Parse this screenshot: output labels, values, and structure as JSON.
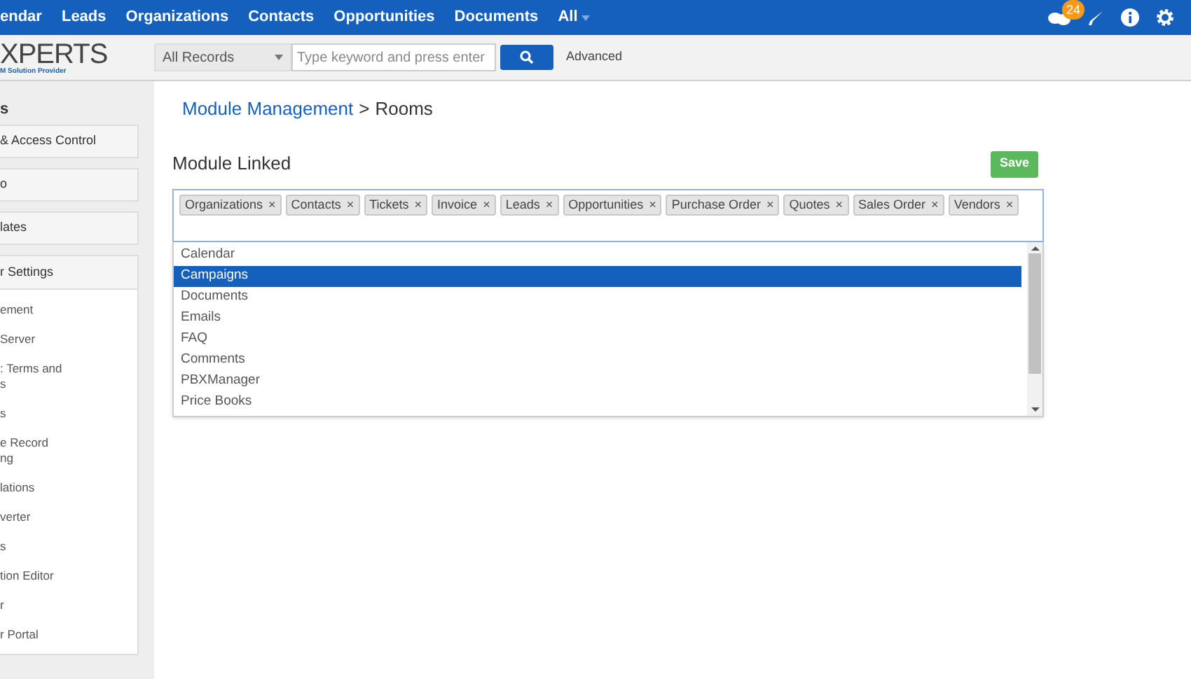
{
  "top_nav": {
    "items": [
      "endar",
      "Leads",
      "Organizations",
      "Contacts",
      "Opportunities",
      "Documents",
      "All"
    ],
    "notification_count": "24"
  },
  "header": {
    "logo": "XPERTS",
    "logo_tagline": "M Solution Provider",
    "search_scope": "All Records",
    "search": {
      "placeholder": "Type keyword and press enter"
    },
    "advanced": "Advanced"
  },
  "sidebar": {
    "title": "s",
    "panels": [
      "& Access Control",
      "o",
      "lates"
    ],
    "open_panel": {
      "title": "r Settings",
      "items": [
        {
          "lines": [
            "ement"
          ]
        },
        {
          "lines": [
            "Server"
          ]
        },
        {
          "lines": [
            ": Terms and",
            "s"
          ]
        },
        {
          "lines": [
            "s"
          ]
        },
        {
          "lines": [
            "e Record",
            "ng"
          ]
        },
        {
          "lines": [
            "lations"
          ]
        },
        {
          "lines": [
            "verter"
          ]
        },
        {
          "lines": [
            "s"
          ]
        },
        {
          "lines": [
            "tion Editor"
          ]
        },
        {
          "lines": [
            "r"
          ]
        },
        {
          "lines": [
            "r Portal"
          ]
        }
      ]
    }
  },
  "breadcrumb": {
    "link": "Module Management",
    "separator": ">",
    "current": "Rooms"
  },
  "section_title": "Module Linked",
  "save_button": "Save",
  "tags": [
    "Organizations",
    "Contacts",
    "Tickets",
    "Invoice",
    "Leads",
    "Opportunities",
    "Purchase Order",
    "Quotes",
    "Sales Order",
    "Vendors"
  ],
  "tag_remove": "×",
  "dropdown_options": [
    {
      "label": "Calendar",
      "selected": false
    },
    {
      "label": "Campaigns",
      "selected": true
    },
    {
      "label": "Documents",
      "selected": false
    },
    {
      "label": "Emails",
      "selected": false
    },
    {
      "label": "FAQ",
      "selected": false
    },
    {
      "label": "Comments",
      "selected": false
    },
    {
      "label": "PBXManager",
      "selected": false
    },
    {
      "label": "Price Books",
      "selected": false
    }
  ]
}
